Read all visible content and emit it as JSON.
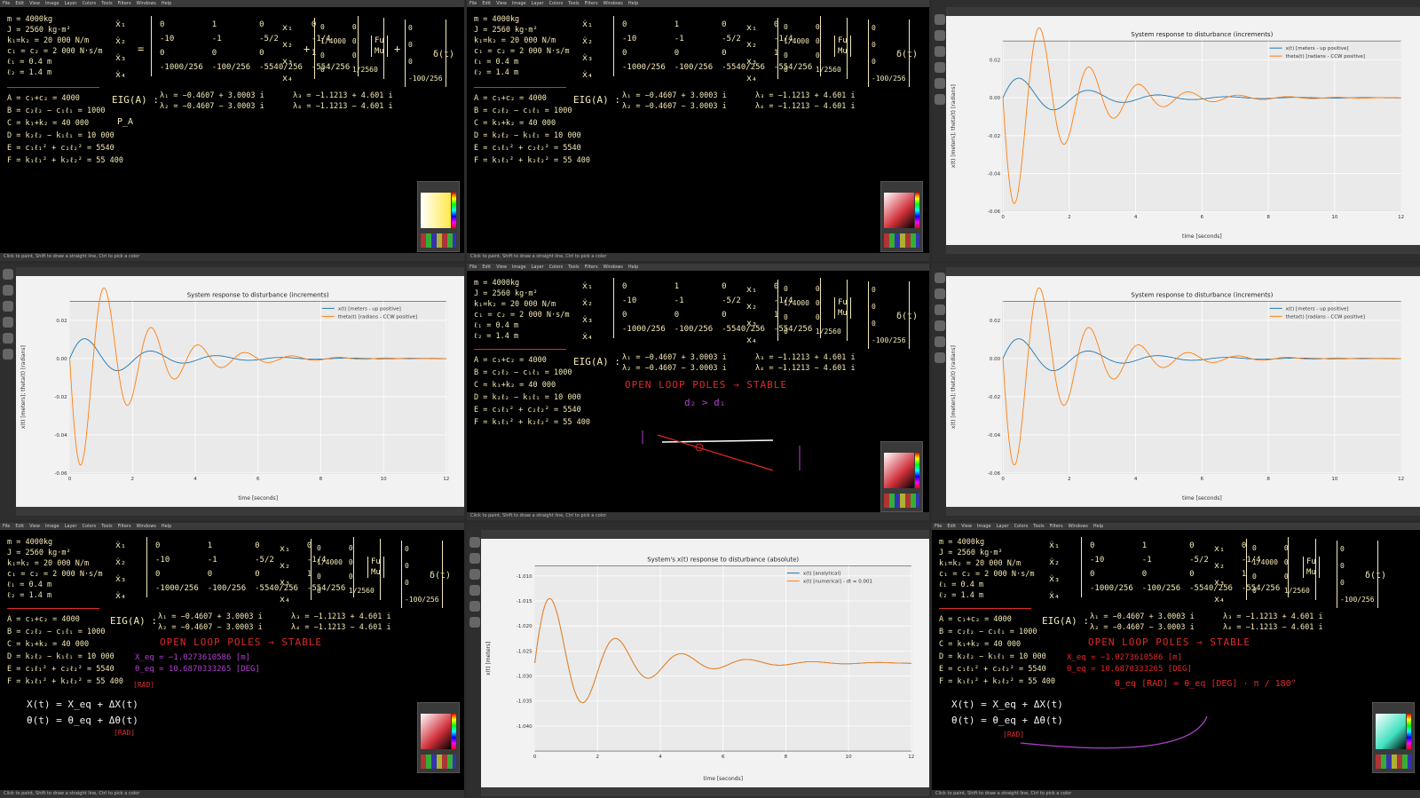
{
  "menu": [
    "File",
    "Edit",
    "View",
    "Image",
    "Layer",
    "Colors",
    "Tools",
    "Filters",
    "Windows",
    "Help"
  ],
  "status_text": "Click to paint, Shift to draw a straight line, Ctrl to pick a color",
  "params": [
    "m = 4000kg",
    "J = 2560 kg·m²",
    "k₁=k₂ = 20 000 N/m",
    "c₁ = c₂ = 2 000 N·s/m",
    "ℓ₁ = 0.4 m",
    "ℓ₂ = 1.4 m"
  ],
  "defs": [
    "A = c₁+c₂ = 4000",
    "B = c₂ℓ₂ − c₁ℓ₁ = 1000",
    "C = k₁+k₂ = 40 000",
    "D = k₂ℓ₂ − k₁ℓ₁ = 10 000",
    "E = c₁ℓ₁² + c₂ℓ₂² = 5540",
    "F = k₁ℓ₁² + k₂ℓ₂² = 55 400"
  ],
  "state_vec": [
    "ẋ₁",
    "ẋ₂",
    "ẋ₃",
    "ẋ₄"
  ],
  "x_vec": [
    "x₁",
    "x₂",
    "x₃",
    "x₄"
  ],
  "A_matrix": [
    [
      "0",
      "1",
      "0",
      "0"
    ],
    [
      "-10",
      "-1",
      "-5/2",
      "-1/4"
    ],
    [
      "0",
      "0",
      "0",
      "1"
    ],
    [
      "-1000/256",
      "-100/256",
      "-5540/256",
      "-554/256"
    ]
  ],
  "B_matrix": [
    [
      "0",
      "0"
    ],
    [
      "1/4000",
      "0"
    ],
    [
      "0",
      "0"
    ],
    [
      "0",
      "1/2560"
    ]
  ],
  "u_vec": [
    "Fu",
    "Mu"
  ],
  "G_vec": [
    "0",
    "0",
    "0",
    "-100/256"
  ],
  "delta": "δ(t)",
  "eig_label": "EIG(A) :",
  "eigs": [
    "λ₁ = −0.4607 + 3.0003 i",
    "λ₂ = −0.4607 − 3.0003 i",
    "λ₃ = −1.1213 + 4.601 i",
    "λ₄ = −1.1213 − 4.601 i"
  ],
  "p_note": "P_A",
  "stable_note": "OPEN LOOP  POLES → STABLE",
  "ineq": "d₂ > d₁",
  "eq_values": [
    "X_eq = −1.0273610586 [m]",
    "θ_eq = 10.6870333265 [DEG]"
  ],
  "lin_eqs": [
    "X(t) = X_eq + ΔX(t)",
    "θ(t) = θ_eq + Δθ(t)"
  ],
  "rad_note": "[RAD]",
  "conv_eq": "θ_eq [RAD] = θ_eq [DEG] · π / 180°",
  "chart_data": [
    {
      "type": "line",
      "title": "System response to disturbance (increments)",
      "xlabel": "time [seconds]",
      "ylabel": "x(t) [meters]; theta(t) [radians]",
      "xlim": [
        0,
        12
      ],
      "ylim": [
        -0.06,
        0.03
      ],
      "xticks": [
        "0",
        "2",
        "4",
        "6",
        "8",
        "10",
        "12"
      ],
      "yticks": [
        "0.02",
        "0.00",
        "-0.02",
        "-0.04",
        "-0.06"
      ],
      "legend": "top-right",
      "grid": true,
      "series": [
        {
          "name": "x(t) [meters - up positive]",
          "color": "#1f77b4",
          "decay": 0.4607,
          "omega": 3.0003,
          "amp": 0.013
        },
        {
          "name": "theta(t) [radians - CCW positive]",
          "color": "#ff7f0e",
          "decay": 0.55,
          "omega": 4.2,
          "amp": -0.068
        }
      ]
    },
    {
      "type": "line",
      "title": "System's x(t) response to disturbance (absolute)",
      "xlabel": "time [seconds]",
      "ylabel": "x(t) [meters]",
      "xlim": [
        0,
        12
      ],
      "ylim": [
        -1.045,
        -1.008
      ],
      "xticks": [
        "0",
        "2",
        "4",
        "6",
        "8",
        "10",
        "12"
      ],
      "yticks": [
        "-1.010",
        "-1.015",
        "-1.020",
        "-1.025",
        "-1.030",
        "-1.035",
        "-1.040"
      ],
      "legend": "top-right",
      "grid": true,
      "offset": -1.0274,
      "series": [
        {
          "name": "x(t) [analytical]",
          "color": "#1f77b4",
          "decay": 0.4607,
          "omega": 3.0003,
          "amp": 0.0162
        },
        {
          "name": "x(t) [numerical] - dt = 0.001",
          "color": "#ff7f0e",
          "decay": 0.4607,
          "omega": 3.0003,
          "amp": 0.0162
        }
      ]
    }
  ]
}
